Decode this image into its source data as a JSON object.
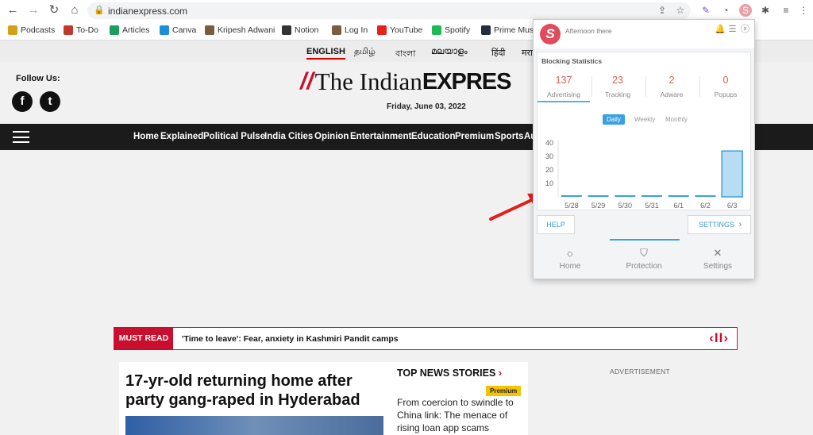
{
  "browser": {
    "url": "indianexpress.com",
    "nav": {
      "back": "←",
      "forward": "→",
      "reload": "↻",
      "home": "⌂"
    },
    "bookmarks": [
      {
        "label": "Podcasts",
        "icon": "podcast-icon",
        "color": "#d4a017"
      },
      {
        "label": "To-Do",
        "icon": "todo-icon",
        "color": "#c0392b"
      },
      {
        "label": "Articles",
        "icon": "drive-icon",
        "color": "#1a9e5a"
      },
      {
        "label": "Canva",
        "icon": "canva-icon",
        "color": "#1a8fd6"
      },
      {
        "label": "Kripesh Adwani",
        "icon": "avatar-icon",
        "color": "#7a5c3e"
      },
      {
        "label": "Notion",
        "icon": "notion-icon",
        "color": "#333333"
      },
      {
        "label": "Log In",
        "icon": "avatar-icon",
        "color": "#7a5c3e"
      },
      {
        "label": "YouTube",
        "icon": "youtube-icon",
        "color": "#e62117"
      },
      {
        "label": "Spotify",
        "icon": "spotify-icon",
        "color": "#1db954"
      },
      {
        "label": "Prime Music",
        "icon": "prime-music-icon",
        "color": "#232f3e"
      }
    ]
  },
  "page": {
    "languages": [
      "ENGLISH",
      "தமிழ்",
      "বাংলা",
      "മലയാളം",
      "हिंदी",
      "मरा"
    ],
    "follow_label": "Follow Us:",
    "social": {
      "facebook": "f",
      "twitter": "t"
    },
    "logo": {
      "part1": "The Indian",
      "part2": "EXPRES"
    },
    "date": "Friday, June 03, 2022",
    "menu": [
      "Home",
      "Explained",
      "Political Pulse",
      "India",
      "Cities",
      "Opinion",
      "Entertainment",
      "Education",
      "Premium",
      "Sports",
      "Au"
    ],
    "must_read": {
      "label": "MUST READ",
      "headline": "'Time to leave': Fear, anxiety in Kashmiri Pandit camps",
      "controls": "‹II›"
    },
    "main_story": "17-yr-old returning home after party gang-raped in Hyderabad",
    "top_news": {
      "title": "TOP NEWS STORIES",
      "chevron": "›"
    },
    "premium_badge": "Premium",
    "side_story": "From coercion to swindle to China link: The menace of rising loan app scams",
    "advertisement": "ADVERTISEMENT"
  },
  "popup": {
    "greeting": "Afternoon there",
    "stats_title": "Blocking Statistics",
    "stats": [
      {
        "value": "137",
        "label": "Advertising"
      },
      {
        "value": "23",
        "label": "Tracking"
      },
      {
        "value": "2",
        "label": "Adware"
      },
      {
        "value": "0",
        "label": "Popups"
      }
    ],
    "periods": [
      "Daily",
      "Weekly",
      "Monthly"
    ],
    "help_label": "HELP",
    "settings_btn_label": "SETTINGS",
    "nav": [
      {
        "label": "Home",
        "icon": "sun-icon"
      },
      {
        "label": "Protection",
        "icon": "shield-icon"
      },
      {
        "label": "Settings",
        "icon": "tools-icon"
      }
    ],
    "accent": "#3aa0e0"
  },
  "chart_data": {
    "type": "bar",
    "categories": [
      "5/28",
      "5/29",
      "5/30",
      "5/31",
      "6/1",
      "6/2",
      "6/3"
    ],
    "values": [
      0,
      0,
      0,
      0,
      0,
      0,
      34
    ],
    "yticks": [
      10,
      20,
      30,
      40
    ],
    "ylim": [
      0,
      40
    ]
  }
}
